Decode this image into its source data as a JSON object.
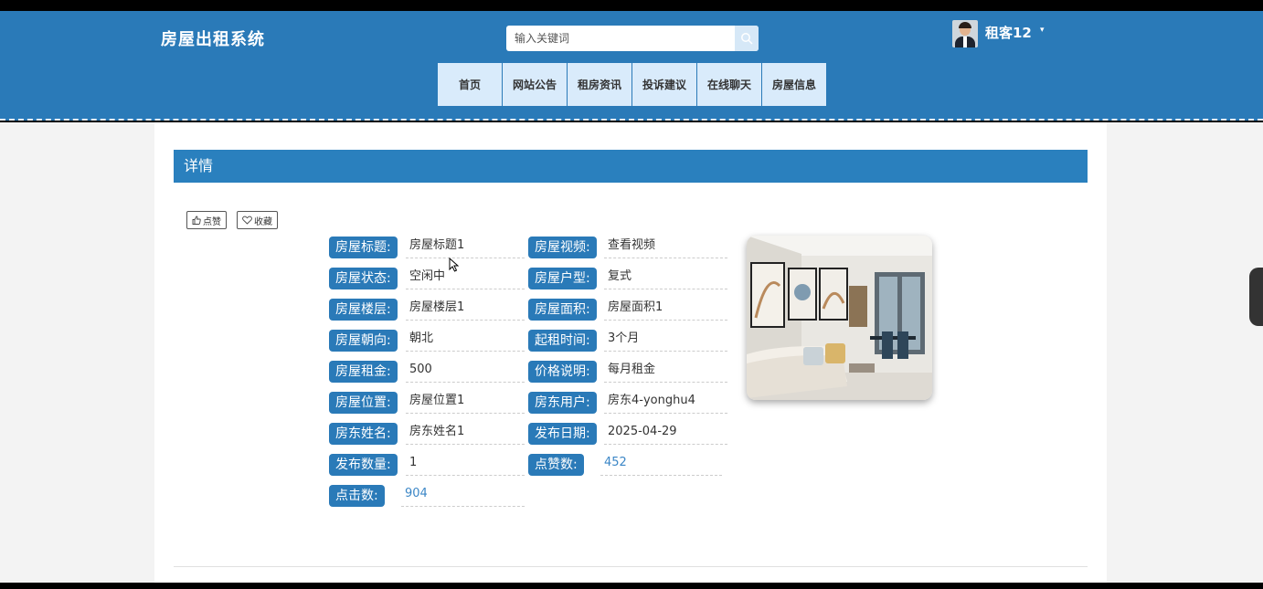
{
  "app": {
    "title": "房屋出租系统"
  },
  "search": {
    "placeholder": "输入关键词"
  },
  "user": {
    "name": "租客12"
  },
  "nav": {
    "items": [
      "首页",
      "网站公告",
      "租房资讯",
      "投诉建议",
      "在线聊天",
      "房屋信息"
    ]
  },
  "detail": {
    "heading": "详情",
    "like_label": "点赞",
    "favorite_label": "收藏",
    "fields": [
      {
        "label": "房屋标题:",
        "value": "房屋标题1"
      },
      {
        "label": "房屋视频:",
        "value": "查看视频"
      },
      {
        "label": "房屋状态:",
        "value": "空闲中"
      },
      {
        "label": "房屋户型:",
        "value": "复式"
      },
      {
        "label": "房屋楼层:",
        "value": "房屋楼层1"
      },
      {
        "label": "房屋面积:",
        "value": "房屋面积1"
      },
      {
        "label": "房屋朝向:",
        "value": "朝北"
      },
      {
        "label": "起租时间:",
        "value": "3个月"
      },
      {
        "label": "房屋租金:",
        "value": "500"
      },
      {
        "label": "价格说明:",
        "value": "每月租金"
      },
      {
        "label": "房屋位置:",
        "value": "房屋位置1"
      },
      {
        "label": "房东用户:",
        "value": "房东4-yonghu4"
      },
      {
        "label": "房东姓名:",
        "value": "房东姓名1"
      },
      {
        "label": "发布日期:",
        "value": "2025-04-29"
      },
      {
        "label": "发布数量:",
        "value": "1"
      },
      {
        "label": "点赞数:",
        "value": "452"
      },
      {
        "label": "点击数:",
        "value": "904"
      }
    ]
  },
  "colors": {
    "primary": "#2a7ab8",
    "nav_bg": "#d9ebfb",
    "section_head": "#2a80be",
    "link_value": "#3b86c6"
  }
}
